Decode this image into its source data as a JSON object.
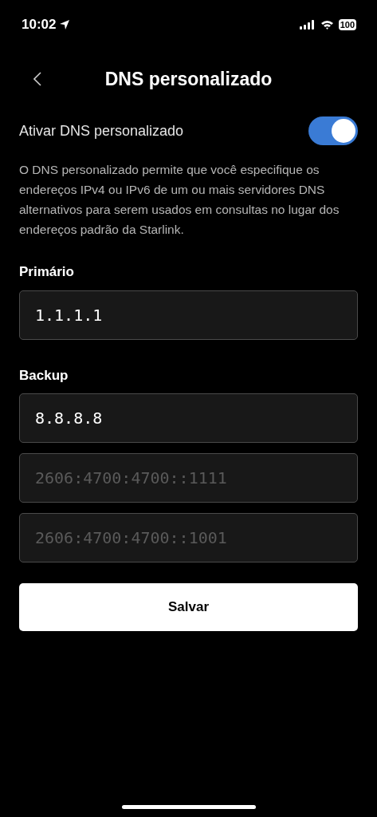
{
  "status_bar": {
    "time": "10:02",
    "battery": "100"
  },
  "header": {
    "title": "DNS personalizado"
  },
  "toggle": {
    "label": "Ativar DNS personalizado",
    "on": true
  },
  "description": "O DNS personalizado permite que você especifique os endereços IPv4 ou IPv6 de um ou mais servidores DNS alternativos para serem usados em consultas no lugar dos endereços padrão da Starlink.",
  "sections": [
    {
      "label": "Primário",
      "fields": [
        {
          "value": "1.1.1.1"
        }
      ]
    },
    {
      "label": "Backup",
      "fields": [
        {
          "value": "8.8.8.8"
        },
        {
          "placeholder": "2606:4700:4700::1111"
        },
        {
          "placeholder": "2606:4700:4700::1001"
        }
      ]
    }
  ],
  "save_button": "Salvar"
}
